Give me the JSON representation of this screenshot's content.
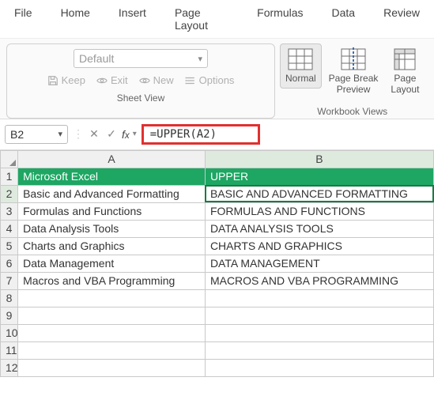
{
  "menubar": [
    "File",
    "Home",
    "Insert",
    "Page Layout",
    "Formulas",
    "Data",
    "Review"
  ],
  "ribbon": {
    "sheetview": {
      "dropdown_placeholder": "Default",
      "buttons": {
        "keep": "Keep",
        "exit": "Exit",
        "new": "New",
        "options": "Options"
      },
      "label": "Sheet View"
    },
    "workbook_views": {
      "items": [
        {
          "label": "Normal",
          "active": true
        },
        {
          "label": "Page Break\nPreview",
          "active": false
        },
        {
          "label": "Page\nLayout",
          "active": false
        }
      ],
      "label": "Workbook Views"
    }
  },
  "namebox": "B2",
  "formula": "=UPPER(A2)",
  "columns": [
    "A",
    "B"
  ],
  "row_count": 12,
  "cells": {
    "A1": "Microsoft Excel",
    "B1": "UPPER",
    "A2": "Basic and Advanced Formatting",
    "B2": "BASIC AND ADVANCED FORMATTING",
    "A3": "Formulas and Functions",
    "B3": "FORMULAS AND FUNCTIONS",
    "A4": "Data Analysis Tools",
    "B4": "DATA ANALYSIS TOOLS",
    "A5": "Charts and Graphics",
    "B5": "CHARTS AND GRAPHICS",
    "A6": "Data Management",
    "B6": "DATA MANAGEMENT",
    "A7": "Macros and VBA Programming",
    "B7": "MACROS AND VBA PROGRAMMING"
  },
  "selected_cell": "B2"
}
